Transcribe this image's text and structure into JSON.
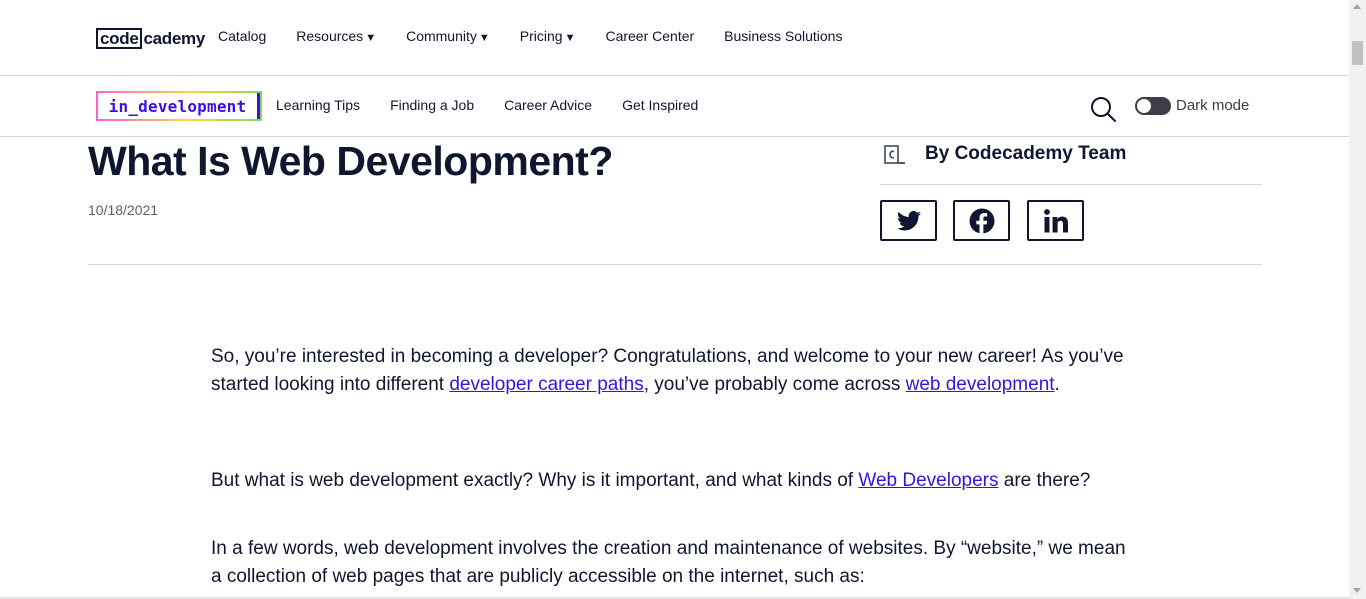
{
  "topnav": {
    "logo_code": "code",
    "logo_cademy": "cademy",
    "items": [
      {
        "label": "Catalog",
        "caret": ""
      },
      {
        "label": "Resources",
        "caret": "▼"
      },
      {
        "label": "Community",
        "caret": "▼"
      },
      {
        "label": "Pricing",
        "caret": "▼"
      },
      {
        "label": "Career Center",
        "caret": ""
      },
      {
        "label": "Business Solutions",
        "caret": ""
      }
    ]
  },
  "subnav": {
    "brand": "in_development",
    "items": [
      "Learning Tips",
      "Finding a Job",
      "Career Advice",
      "Get Inspired"
    ],
    "dark_mode_label": "Dark mode"
  },
  "article": {
    "title": "What Is Web Development?",
    "date": "10/18/2021",
    "author": "By Codecademy Team",
    "paragraphs": {
      "p1": {
        "t1": "So, you’re interested in becoming a developer? Congratulations, and welcome to your new career! As you’ve started looking into different ",
        "link1": "developer career paths",
        "t2": ", you’ve probably come across ",
        "link2": "web development",
        "t3": "."
      },
      "p2": {
        "t1": "But what is web development exactly? Why is it important, and what kinds of ",
        "link1": "Web Developers",
        "t2": " are there?"
      },
      "p3": {
        "t1": "In a few words, web development involves the creation and maintenance of websites. By “website,” we mean a collection of web pages that are publicly accessible on the internet, such as:"
      }
    }
  },
  "colors": {
    "text": "#10162f",
    "link": "#3a10e5",
    "divider": "#d6d6d6"
  }
}
